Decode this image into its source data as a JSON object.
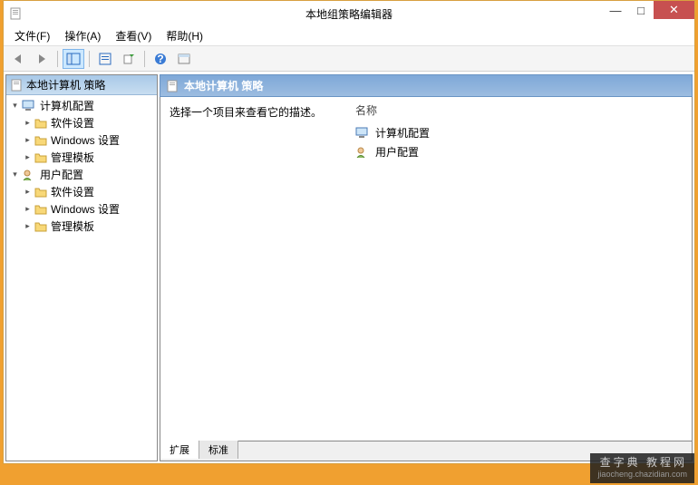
{
  "window": {
    "title": "本地组策略编辑器",
    "buttons": {
      "min": "—",
      "max": "□",
      "close": "✕"
    }
  },
  "menu": {
    "file": "文件(F)",
    "action": "操作(A)",
    "view": "查看(V)",
    "help": "帮助(H)"
  },
  "tree": {
    "root": "本地计算机 策略",
    "nodes": [
      {
        "label": "计算机配置",
        "children": [
          "软件设置",
          "Windows 设置",
          "管理模板"
        ]
      },
      {
        "label": "用户配置",
        "children": [
          "软件设置",
          "Windows 设置",
          "管理模板"
        ]
      }
    ]
  },
  "panel": {
    "title": "本地计算机 策略",
    "desc": "选择一个项目来查看它的描述。",
    "col_header": "名称",
    "items": [
      "计算机配置",
      "用户配置"
    ]
  },
  "tabs": {
    "extended": "扩展",
    "standard": "标准"
  },
  "watermark": {
    "line1": "查字典 教程网",
    "line2": "jiaocheng.chazidian.com"
  }
}
